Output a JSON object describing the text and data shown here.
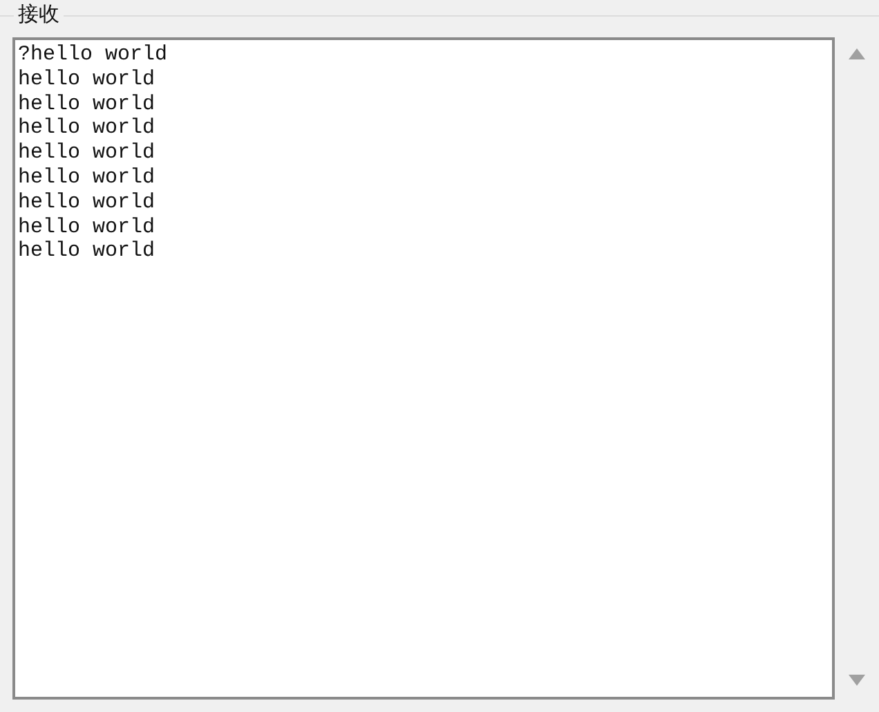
{
  "group": {
    "title": "接收"
  },
  "receive_box": {
    "lines": [
      "?hello world",
      "hello world",
      "hello world",
      "hello world",
      "hello world",
      "hello world",
      "hello world",
      "hello world",
      "hello world"
    ]
  }
}
